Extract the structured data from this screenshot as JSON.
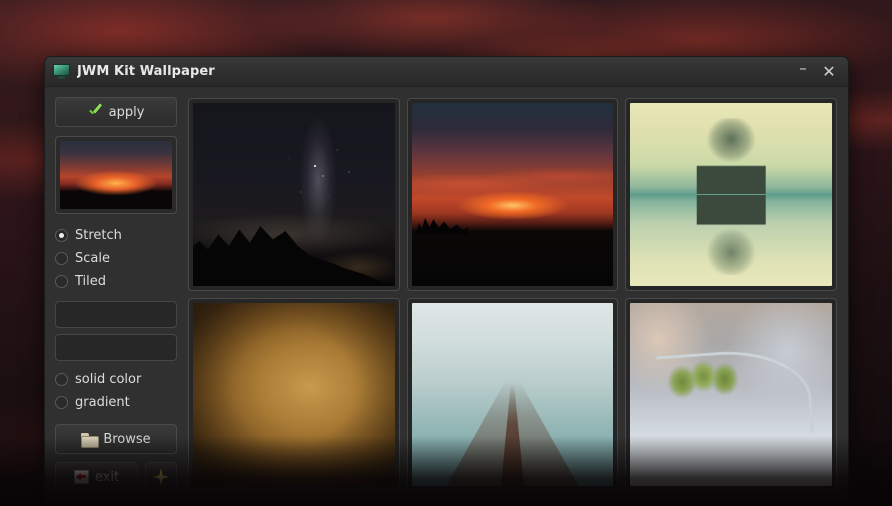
{
  "window": {
    "title": "JWM Kit Wallpaper",
    "icon": "monitor-icon",
    "minimize_label": "–",
    "close_label": "✕"
  },
  "sidebar": {
    "apply_label": "apply",
    "apply_icon": "green-check-icon",
    "preview": {
      "name": "current-wallpaper-preview",
      "description": "red sunset over silhouetted field"
    },
    "modes": [
      {
        "label": "Stretch",
        "selected": true
      },
      {
        "label": "Scale",
        "selected": false
      },
      {
        "label": "Tiled",
        "selected": false
      }
    ],
    "inputs": [
      {
        "name": "color-field",
        "value": "",
        "placeholder": ""
      },
      {
        "name": "gradient-field",
        "value": "",
        "placeholder": ""
      }
    ],
    "fill_options": [
      {
        "label": "solid color",
        "selected": false
      },
      {
        "label": "gradient",
        "selected": false
      }
    ],
    "browse_label": "Browse",
    "browse_icon": "folder-icon",
    "exit_label": "exit",
    "exit_icon": "exit-door-icon",
    "star_icon": "sparkle-star-icon"
  },
  "gallery": {
    "thumbnails": [
      {
        "name": "wallpaper-milky-way",
        "style": "img-milkyway",
        "description": "Milky Way night sky over treeline"
      },
      {
        "name": "wallpaper-red-sunset",
        "style": "img-sunset",
        "description": "Red sunset over dark horizon"
      },
      {
        "name": "wallpaper-tree-reflection",
        "style": "img-tree",
        "description": "Tree reflected in still water"
      },
      {
        "name": "wallpaper-mayan-relief",
        "style": "img-relief",
        "description": "Carved Mayan stone relief"
      },
      {
        "name": "wallpaper-foggy-railway",
        "style": "img-rail",
        "description": "Railway track vanishing into fog"
      },
      {
        "name": "wallpaper-frosted-branch",
        "style": "img-frost",
        "description": "Frost covered branch with green leaves"
      }
    ]
  },
  "colors": {
    "window_bg": "#303030",
    "titlebar_bg": "#2f2f2f",
    "text": "#dcdcdc",
    "accent_check": "#8ce052",
    "accent_star": "#ffe14a",
    "desktop_sky": "#2b1418"
  }
}
